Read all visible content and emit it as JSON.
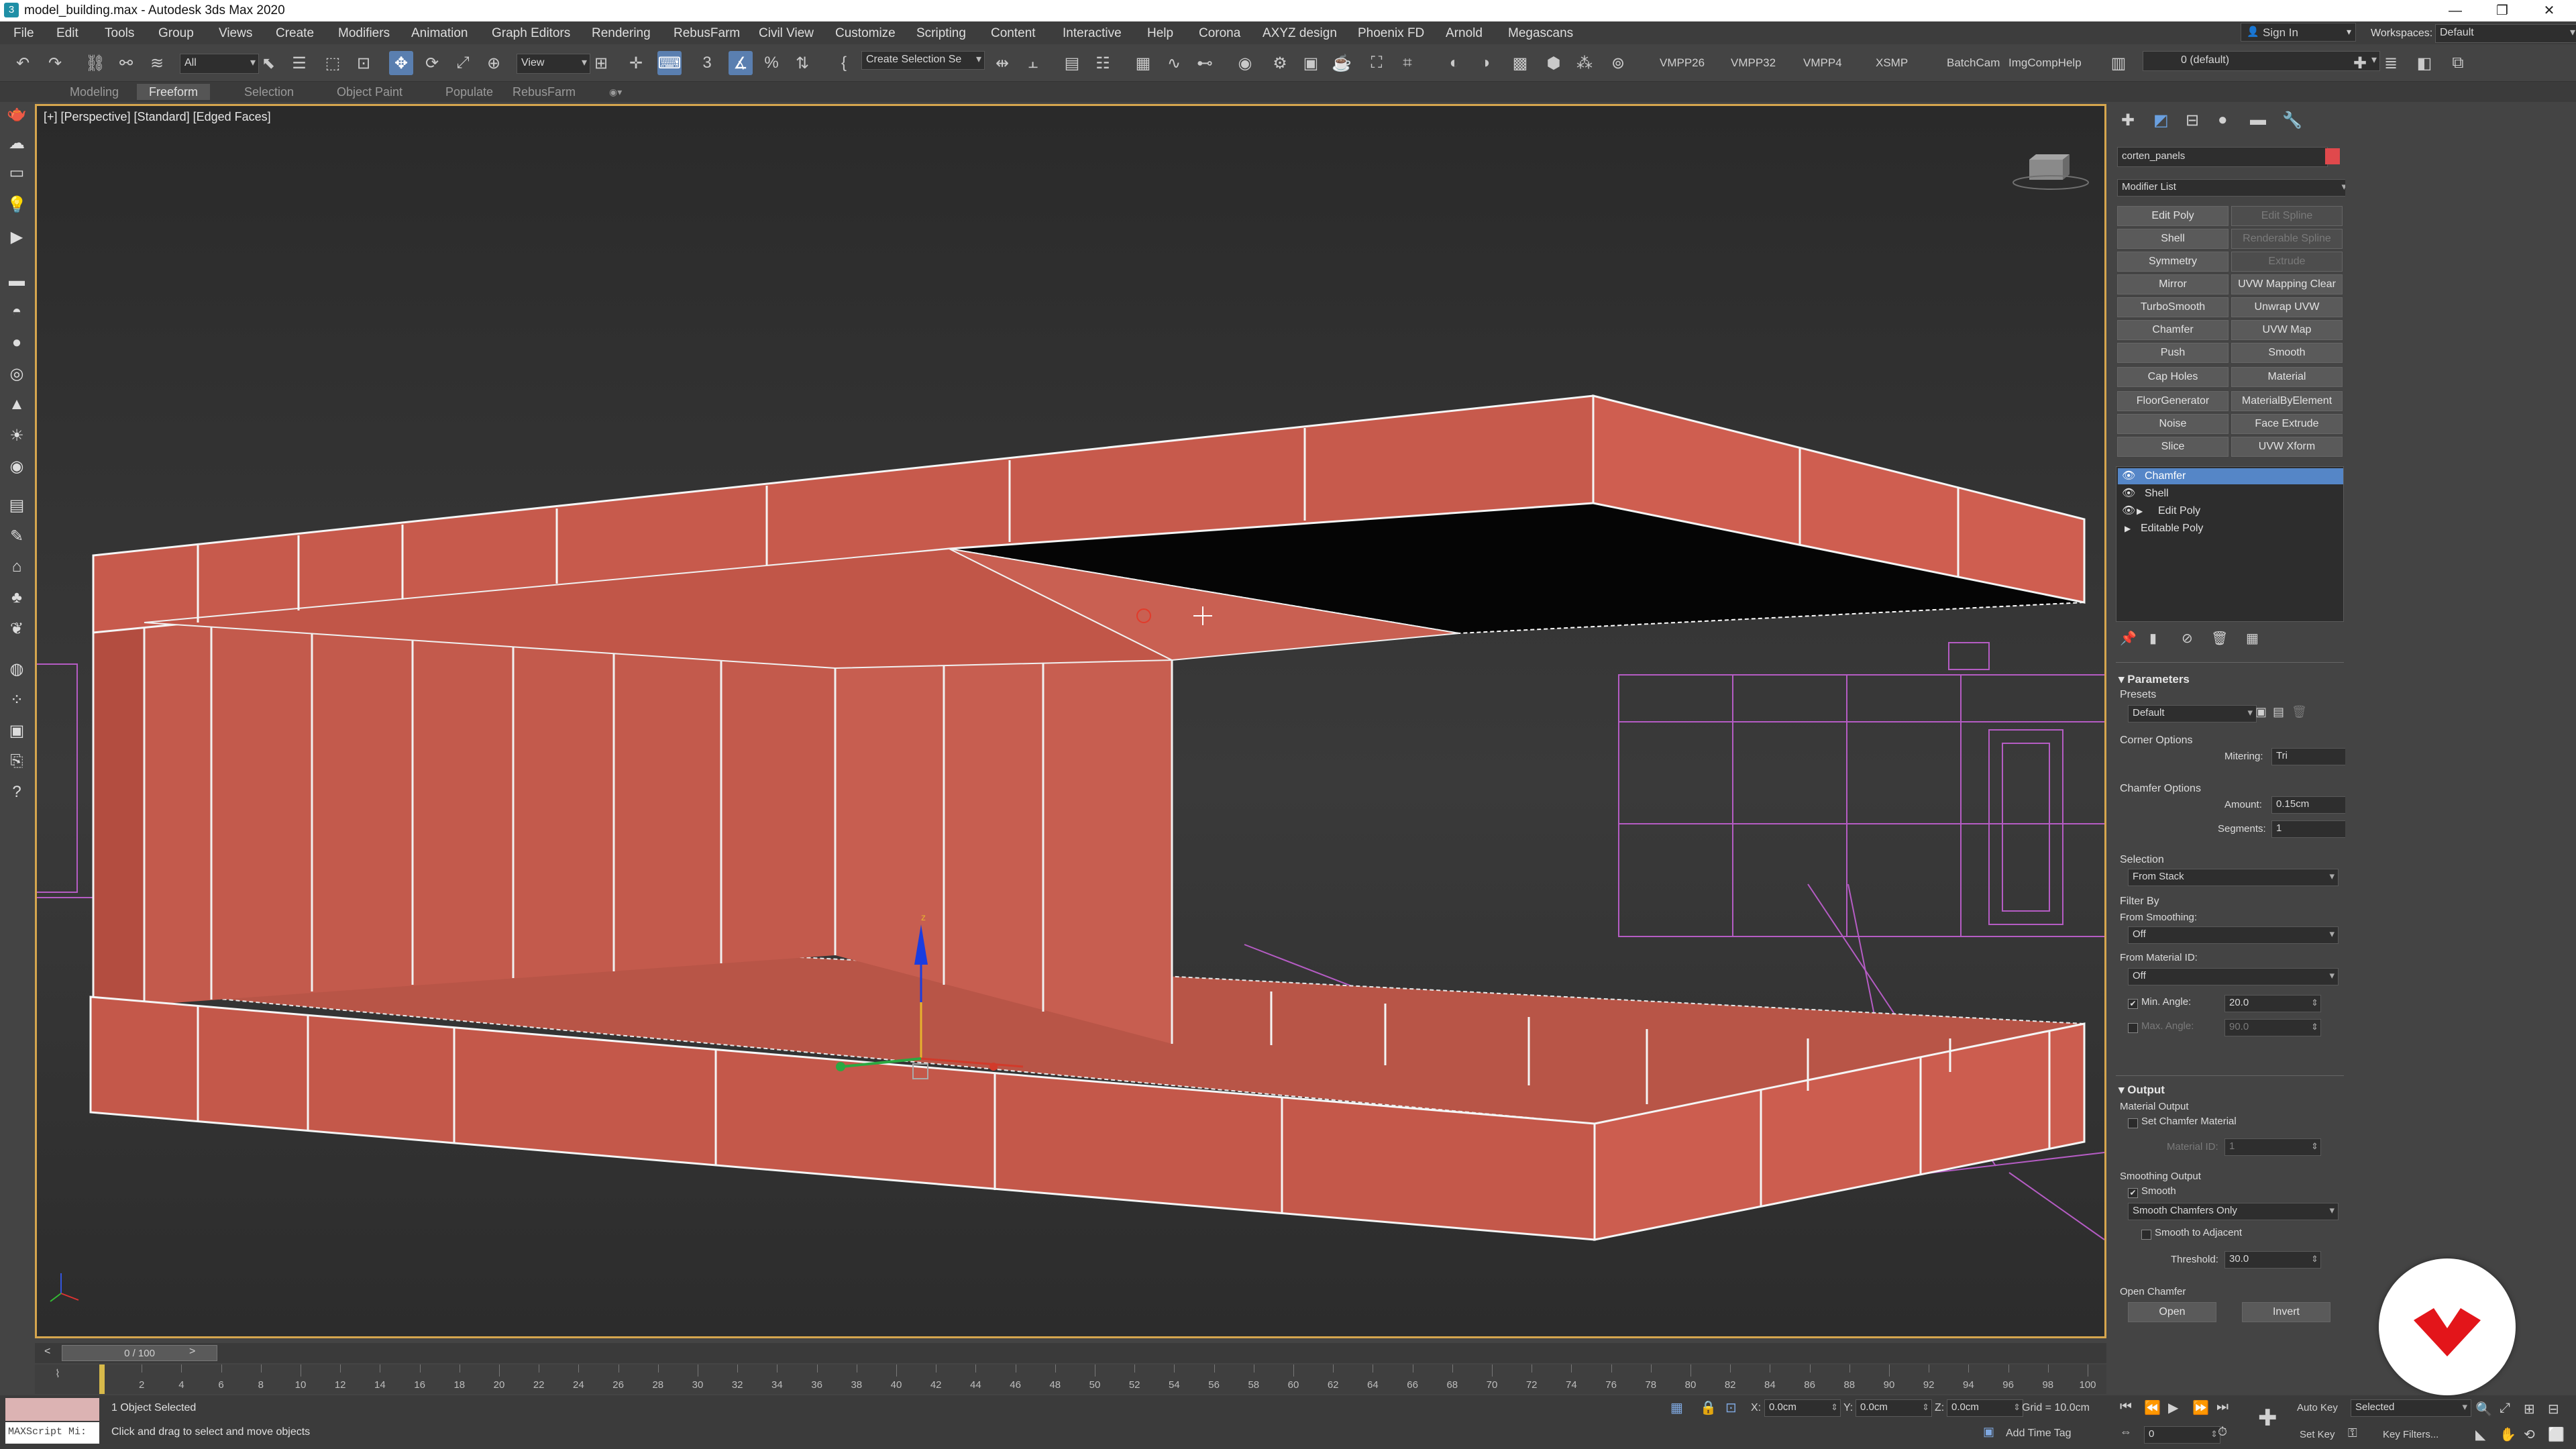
{
  "title_bar": {
    "title": "model_building.max - Autodesk 3ds Max 2020",
    "app_icon": "3ds-max-icon"
  },
  "menu": {
    "items": [
      "File",
      "Edit",
      "Tools",
      "Group",
      "Views",
      "Create",
      "Modifiers",
      "Animation",
      "Graph Editors",
      "Rendering",
      "RebusFarm",
      "Civil View",
      "Customize",
      "Scripting",
      "Content",
      "Interactive",
      "Help",
      "Corona",
      "AXYZ design",
      "Phoenix FD",
      "Arnold",
      "Megascans"
    ],
    "sign_in": "Sign In",
    "workspaces_label": "Workspaces:",
    "workspaces_value": "Default"
  },
  "toolbar": {
    "selection_filter": "All",
    "ref_coord": "View",
    "named_selection": "Create Selection Se",
    "script_buttons": [
      "VMPP26",
      "VMPP32",
      "VMPP4",
      "XSMP",
      "BatchCam",
      "ImgCompHelp"
    ],
    "layer": "0 (default)"
  },
  "ribbon": {
    "tabs": [
      "Modeling",
      "Freeform",
      "Selection",
      "Object Paint",
      "Populate",
      "RebusFarm"
    ],
    "active": "Freeform"
  },
  "viewport": {
    "label": "[+] [Perspective] [Standard] [Edged Faces]",
    "axis_z": "z"
  },
  "command_panel": {
    "object_name": "corten_panels",
    "object_color": "#e0494c",
    "modifier_list": "Modifier List",
    "modifier_buttons": [
      [
        "Edit Poly",
        "Edit Spline"
      ],
      [
        "Shell",
        "Renderable Spline"
      ],
      [
        "Symmetry",
        "Extrude"
      ],
      [
        "Mirror",
        "UVW Mapping Clear"
      ],
      [
        "TurboSmooth",
        "Unwrap UVW"
      ],
      [
        "Chamfer",
        "UVW Map"
      ],
      [
        "Push",
        "Smooth"
      ],
      [
        "Cap Holes",
        "Material"
      ],
      [
        "FloorGenerator",
        "MaterialByElement"
      ],
      [
        "Noise",
        "Face Extrude"
      ],
      [
        "Slice",
        "UVW Xform"
      ]
    ],
    "disabled_buttons": [
      "Edit Spline",
      "Renderable Spline",
      "Extrude"
    ],
    "stack": [
      "Chamfer",
      "Shell",
      "Edit Poly",
      "Editable Poly"
    ],
    "stack_selected": "Chamfer",
    "parameters": {
      "title": "Parameters",
      "presets_label": "Presets",
      "presets_value": "Default",
      "corner_options": "Corner Options",
      "mitering_label": "Mitering:",
      "mitering_value": "Tri",
      "chamfer_options": "Chamfer Options",
      "amount_label": "Amount:",
      "amount_value": "0.15cm",
      "segments_label": "Segments:",
      "segments_value": "1",
      "selection_label": "Selection",
      "selection_value": "From Stack",
      "filter_by": "Filter By",
      "from_smoothing_label": "From Smoothing:",
      "from_smoothing_value": "Off",
      "from_material_label": "From Material ID:",
      "from_material_value": "Off",
      "min_angle_label": "Min. Angle:",
      "min_angle_value": "20.0",
      "max_angle_label": "Max. Angle:",
      "max_angle_value": "90.0"
    },
    "output": {
      "title": "Output",
      "material_output": "Material Output",
      "set_chamfer_material": "Set Chamfer Material",
      "material_id_label": "Material ID:",
      "material_id_value": "1",
      "smoothing_output": "Smoothing Output",
      "smooth_label": "Smooth",
      "smooth_mode": "Smooth Chamfers Only",
      "smooth_adjacent": "Smooth to Adjacent",
      "threshold_label": "Threshold:",
      "threshold_value": "30.0",
      "open_chamfer": "Open Chamfer",
      "open_button": "Open",
      "invert_button": "Invert"
    }
  },
  "timeline": {
    "frame_display": "0 / 100",
    "ticks": [
      0,
      2,
      4,
      6,
      8,
      10,
      12,
      14,
      16,
      18,
      20,
      22,
      24,
      26,
      28,
      30,
      32,
      34,
      36,
      38,
      40,
      42,
      44,
      46,
      48,
      50,
      52,
      54,
      56,
      58,
      60,
      62,
      64,
      66,
      68,
      70,
      72,
      74,
      76,
      78,
      80,
      82,
      84,
      86,
      88,
      90,
      92,
      94,
      96,
      98,
      100
    ]
  },
  "status": {
    "maxscript": "MAXScript Mi:",
    "selected": "1 Object Selected",
    "prompt": "Click and drag to select and move objects",
    "x_label": "X:",
    "x_value": "0.0cm",
    "y_label": "Y:",
    "y_value": "0.0cm",
    "z_label": "Z:",
    "z_value": "0.0cm",
    "grid": "Grid = 10.0cm",
    "add_time_tag": "Add Time Tag",
    "auto_key": "Auto Key",
    "set_key": "Set Key",
    "key_mode": "Selected",
    "key_filters": "Key Filters...",
    "frame_field": "0"
  },
  "colors": {
    "accent": "#5586c7",
    "corten": "#c9574a",
    "viewport_border": "#d6a64e",
    "logo": "#e3151a"
  }
}
